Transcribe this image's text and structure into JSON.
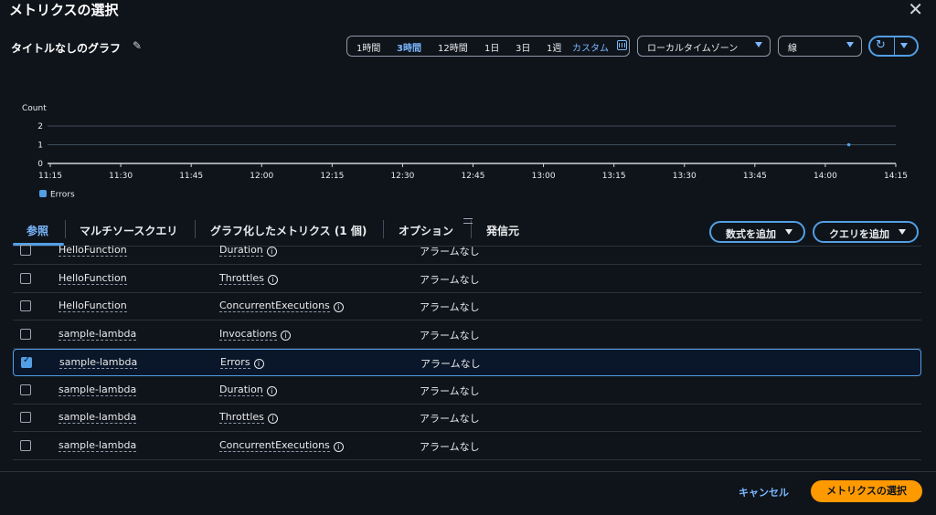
{
  "modal": {
    "title": "メトリクスの選択"
  },
  "graph": {
    "title": "タイトルなしのグラフ"
  },
  "time_range": {
    "options": [
      "1時間",
      "3時間",
      "12時間",
      "1日",
      "3日",
      "1週",
      "カスタム"
    ],
    "selected": "3時間"
  },
  "timezone": {
    "value": "ローカルタイムゾーン"
  },
  "chart_type": {
    "value": "線"
  },
  "chart_data": {
    "type": "line",
    "ylabel": "Count",
    "ylim": [
      0,
      2
    ],
    "yticks": [
      "0",
      "1",
      "2"
    ],
    "xticks": [
      "11:15",
      "11:30",
      "11:45",
      "12:00",
      "12:15",
      "12:30",
      "12:45",
      "13:00",
      "13:15",
      "13:30",
      "13:45",
      "14:00",
      "14:15"
    ],
    "series": [
      {
        "name": "Errors",
        "color": "#539fe5",
        "points": [
          {
            "x": "14:05",
            "y": 1
          }
        ]
      }
    ]
  },
  "tabs": [
    "参照",
    "マルチソースクエリ",
    "グラフ化したメトリクス (1 個)",
    "オプション",
    "発信元"
  ],
  "actions": {
    "add_math": "数式を追加",
    "add_query": "クエリを追加"
  },
  "rows": [
    {
      "function": "HelloFunction",
      "metric": "Duration",
      "alarm": "アラームなし",
      "checked": false
    },
    {
      "function": "HelloFunction",
      "metric": "Throttles",
      "alarm": "アラームなし",
      "checked": false
    },
    {
      "function": "HelloFunction",
      "metric": "ConcurrentExecutions",
      "alarm": "アラームなし",
      "checked": false
    },
    {
      "function": "sample-lambda",
      "metric": "Invocations",
      "alarm": "アラームなし",
      "checked": false
    },
    {
      "function": "sample-lambda",
      "metric": "Errors",
      "alarm": "アラームなし",
      "checked": true
    },
    {
      "function": "sample-lambda",
      "metric": "Duration",
      "alarm": "アラームなし",
      "checked": false
    },
    {
      "function": "sample-lambda",
      "metric": "Throttles",
      "alarm": "アラームなし",
      "checked": false
    },
    {
      "function": "sample-lambda",
      "metric": "ConcurrentExecutions",
      "alarm": "アラームなし",
      "checked": false
    }
  ],
  "footer": {
    "cancel": "キャンセル",
    "confirm": "メトリクスの選択"
  }
}
